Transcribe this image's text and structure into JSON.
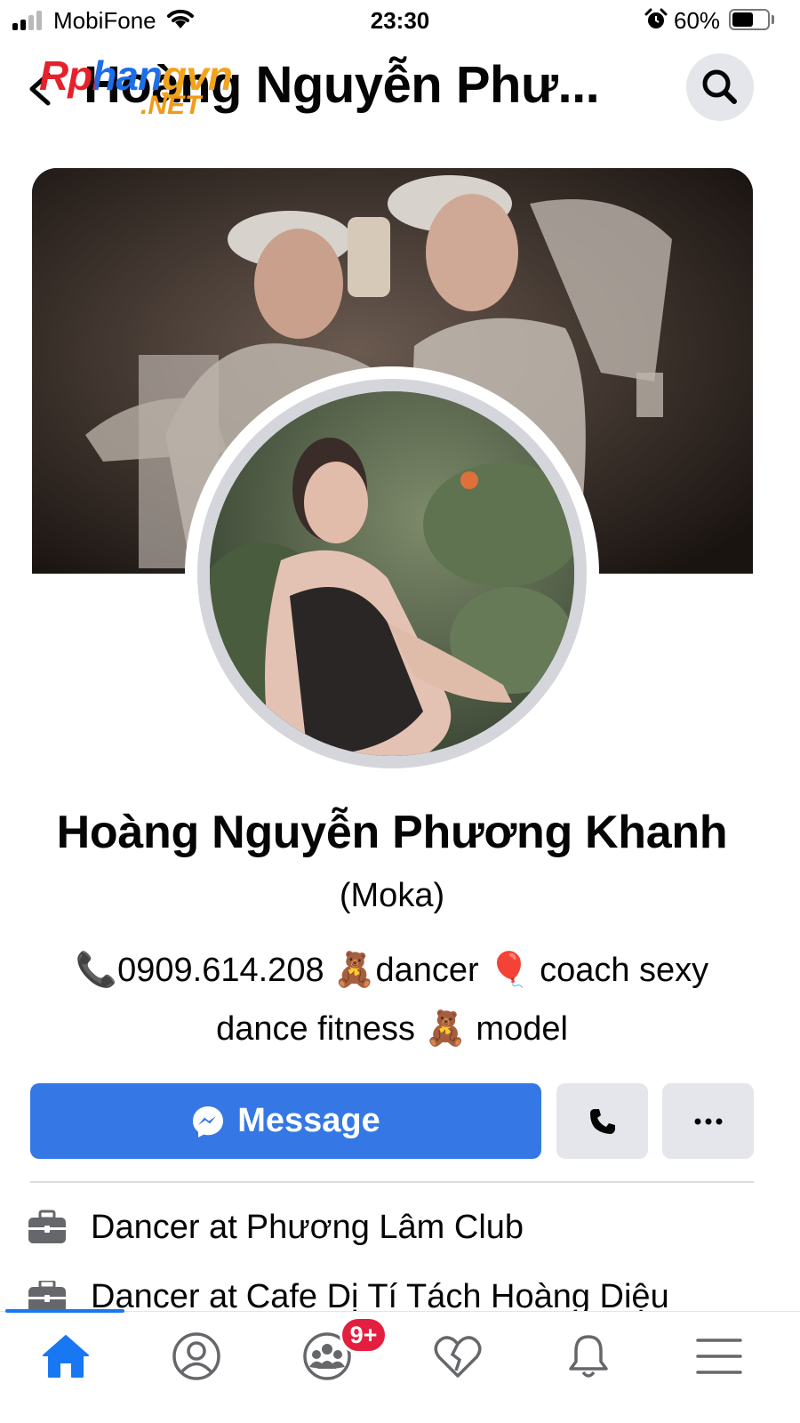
{
  "status_bar": {
    "carrier": "MobiFone",
    "time": "23:30",
    "battery": "60%",
    "battery_level": 0.6
  },
  "header": {
    "title": "Hoàng Nguyễn Phư...",
    "watermark_main": "Rphangvn",
    "watermark_sub": ".NET"
  },
  "profile": {
    "name": "Hoàng Nguyễn Phương Khanh",
    "alternate_name": "(Moka)",
    "bio_line1": "📞0909.614.208 🧸dancer 🎈 coach sexy",
    "bio_line2": "dance fitness 🧸 model"
  },
  "actions": {
    "message_label": "Message"
  },
  "work": [
    {
      "prefix": "Dancer at",
      "place": "Phương Lâm Club"
    },
    {
      "prefix": "Dancer at",
      "place": "Cafe Dị Tí Tách Hoàng Diệu"
    }
  ],
  "tab_bar": {
    "groups_badge": "9+",
    "active_tab": "home"
  },
  "colors": {
    "accent": "#1877f2",
    "message_button": "#3578e5",
    "secondary_button": "#e4e6eb",
    "badge": "#e41e3f"
  },
  "icons": [
    "back-icon",
    "search-icon",
    "messenger-icon",
    "phone-icon",
    "more-icon",
    "briefcase-icon",
    "home-icon",
    "profile-icon",
    "groups-icon",
    "dating-icon",
    "bell-icon",
    "menu-icon"
  ]
}
